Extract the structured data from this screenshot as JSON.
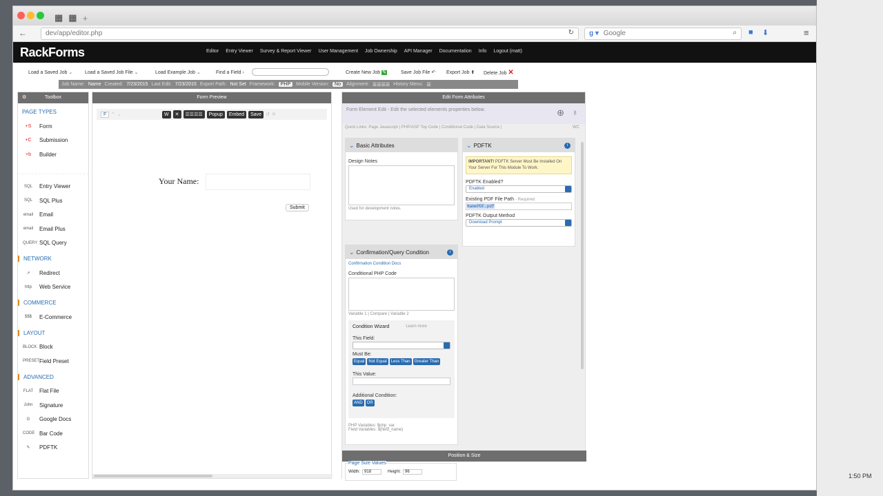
{
  "browser": {
    "url": "dev/app/editor.php",
    "search_placeholder": "Google"
  },
  "system": {
    "clock": "1:50 PM"
  },
  "app": {
    "logo": "RackForms",
    "nav": [
      "Editor",
      "Entry Viewer",
      "Survey & Report Viewer",
      "User Management",
      "Job Ownership",
      "API Manager",
      "Documentation",
      "Info",
      "Logout (matt)"
    ]
  },
  "jobbar": {
    "load_saved": "Load a Saved Job",
    "load_saved_file": "Load a Saved Job File",
    "load_example": "Load Example Job",
    "find_field": "Find a Field",
    "create_new": "Create New Job",
    "save_file": "Save Job File",
    "export": "Export Job",
    "delete": "Delete Job"
  },
  "infobar": {
    "job_name_label": "Job Name:",
    "job_name": "Name",
    "created_label": "Created:",
    "created": "7/23/2015",
    "last_edit_label": "Last Edit:",
    "last_edit": "7/23/2015",
    "export_label": "Export Path:",
    "export": "Not Set",
    "framework_label": "Framework:",
    "framework": "PHP",
    "mobile_label": "Mobile Version:",
    "mobile": "No",
    "alignment_label": "Alignment:",
    "history_label": "History Menu:"
  },
  "toolbox": {
    "title": "Toolbox",
    "page_types_label": "PAGE TYPES",
    "page_types": [
      {
        "icon": "+S",
        "label": "Form"
      },
      {
        "icon": "+C",
        "label": "Submission"
      },
      {
        "icon": "+b",
        "label": "Builder"
      }
    ],
    "sql_items": [
      {
        "icon": "SQL",
        "label": "Entry Viewer"
      },
      {
        "icon": "SQL",
        "label": "SQL Plus"
      },
      {
        "icon": "email",
        "label": "Email"
      },
      {
        "icon": "email",
        "label": "Email Plus"
      },
      {
        "icon": "QUERY",
        "label": "SQL Query"
      }
    ],
    "network_label": "NETWORK",
    "network": [
      {
        "icon": "↗",
        "label": "Redirect"
      },
      {
        "icon": "http",
        "label": "Web Service"
      }
    ],
    "commerce_label": "COMMERCE",
    "commerce": [
      {
        "icon": "$$$",
        "label": "E-Commerce"
      }
    ],
    "layout_label": "LAYOUT",
    "layout": [
      {
        "icon": "BLOCK",
        "label": "Block"
      },
      {
        "icon": "PRESET",
        "label": "Field Preset"
      }
    ],
    "advanced_label": "ADVANCED",
    "advanced": [
      {
        "icon": "FLAT",
        "label": "Flat File"
      },
      {
        "icon": "John",
        "label": "Signature"
      },
      {
        "icon": "G",
        "label": "Google Docs"
      },
      {
        "icon": "CODE",
        "label": "Bar Code"
      },
      {
        "icon": "✎",
        "label": "PDFTK"
      }
    ]
  },
  "preview": {
    "title": "Form Preview",
    "tools": [
      "F",
      "Popup",
      "Embed",
      "Save"
    ],
    "your_name_label": "Your Name:",
    "submit_label": "Submit"
  },
  "attrs": {
    "title": "Edit Form Attributes",
    "intro": "Form Element Edit - Edit the selected elements properties below.",
    "quick_links": "Quick Links: Page Javascript | PHP/ASP Top Code | Conditional Code | Data Source |",
    "wc": "WC",
    "basic": {
      "title": "Basic Attributes",
      "design_notes_label": "Design Notes",
      "design_notes_help": "Used for development notes."
    },
    "confirm": {
      "title": "Confirmation/Query Condition",
      "docs": "Confirmation Condition Docs",
      "code_label": "Conditional PHP Code",
      "vars": "Variable 1 | Compare | Variable 2",
      "wizard_title": "Condition Wizard",
      "learn_more": "Learn more",
      "this_field_label": "This Field:",
      "must_be_label": "Must Be:",
      "compare_buttons": [
        "Equal",
        "Not Equal",
        "Less Than",
        "Greater Than"
      ],
      "this_value_label": "This Value:",
      "additional_label": "Additional Condition:",
      "logic_buttons": [
        "AND",
        "OR"
      ],
      "php_vars": "PHP Variables: $php_var",
      "field_vars": "Field Variables: $(field_name)"
    },
    "pdftk": {
      "title": "PDFTK",
      "important_strong": "IMPORTANT!",
      "important_text": "PDFTK Server Must Be Installed On Your Server For This Module To Work.",
      "enabled_label": "PDFTK Enabled?",
      "enabled_value": "Enabled",
      "path_label": "Existing PDF File Path",
      "path_required": "- Required",
      "path_value": "NamePDF.pdf",
      "output_label": "PDFTK Output Method",
      "output_value": "Download Prompt"
    },
    "position": {
      "title": "Position & Size",
      "page_size_label": "Page Size Values",
      "width_label": "Width:",
      "width": "918",
      "height_label": "Height:",
      "height": "96"
    }
  }
}
